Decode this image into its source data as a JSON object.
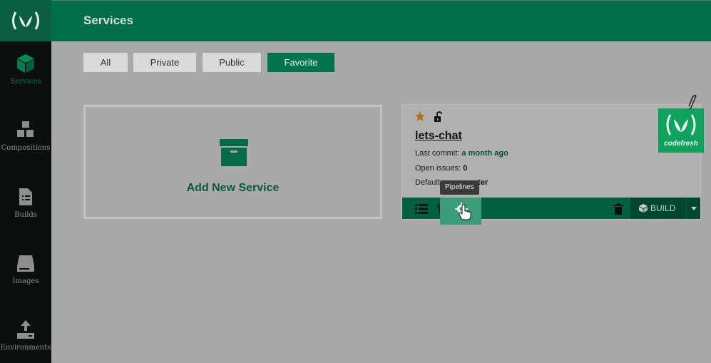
{
  "header": {
    "title": "Services"
  },
  "sidebar": {
    "logo": "(\\V)",
    "items": [
      {
        "label": "Services",
        "icon": "cube-icon",
        "active": true
      },
      {
        "label": "Compositions",
        "icon": "cubes-icon"
      },
      {
        "label": "Builds",
        "icon": "document-list-icon"
      },
      {
        "label": "Images",
        "icon": "drive-icon"
      },
      {
        "label": "Environments",
        "icon": "upload-icon"
      }
    ]
  },
  "filters": [
    {
      "label": "All"
    },
    {
      "label": "Private"
    },
    {
      "label": "Public"
    },
    {
      "label": "Favorite",
      "active": true
    }
  ],
  "add_service": {
    "label": "Add New Service"
  },
  "service_card": {
    "name": "lets-chat",
    "last_commit_label": "Last commit:",
    "last_commit_value": "a month ago",
    "open_issues_label": "Open issues:",
    "open_issues_value": "0",
    "default_branch_label": "Default",
    "default_branch_value": "aster",
    "build_label": "BUILD",
    "tooltip": "Pipelines",
    "badge_word": "codefresh"
  },
  "colors": {
    "brand_green": "#006e4b",
    "active_filter": "#00754d",
    "star": "#b56a12"
  }
}
